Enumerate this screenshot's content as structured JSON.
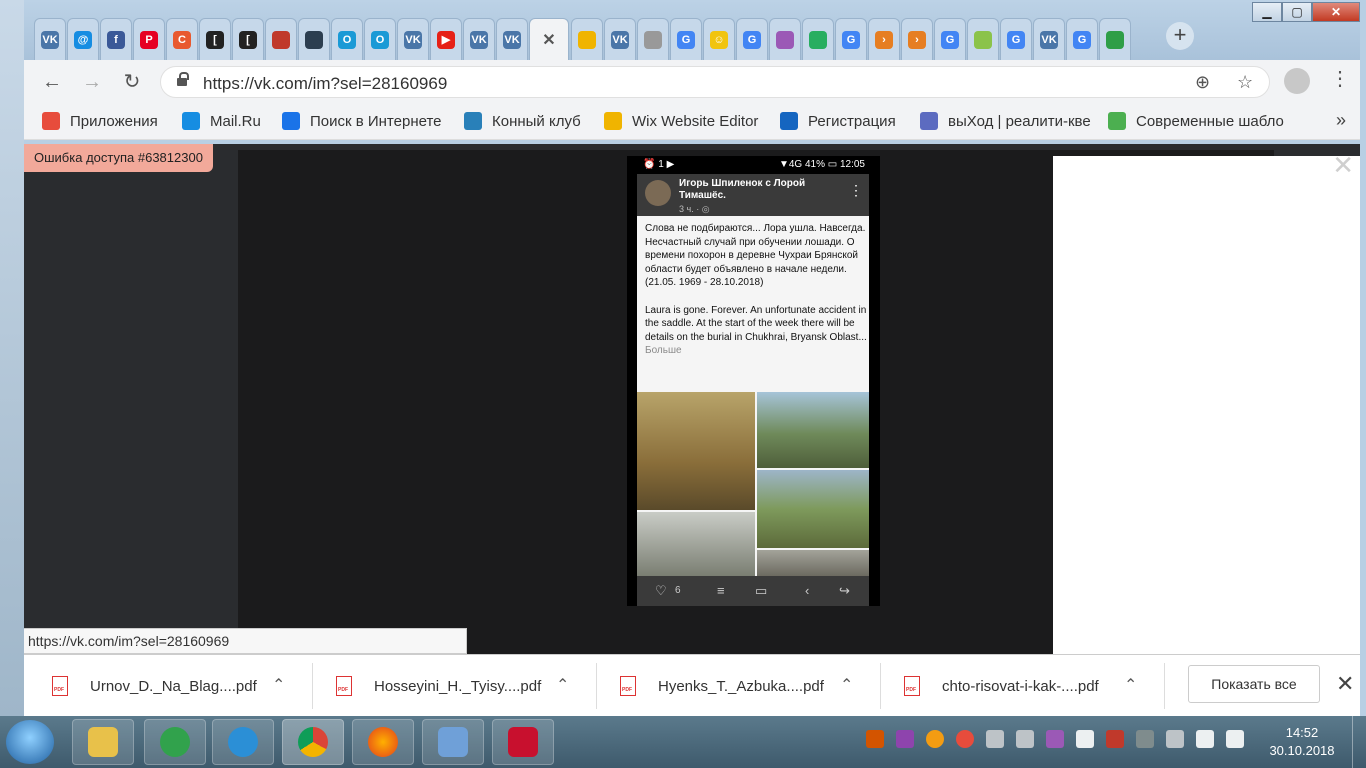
{
  "browser": {
    "url": "https://vk.com/im?sel=28160969",
    "tabs": [
      {
        "icon": "vk-icon",
        "glyph": "VK",
        "color": "#4a76a8"
      },
      {
        "icon": "mailru-icon",
        "glyph": "@",
        "color": "#168de2"
      },
      {
        "icon": "facebook-icon",
        "glyph": "f",
        "color": "#3b5998"
      },
      {
        "icon": "pinterest-icon",
        "glyph": "P",
        "color": "#e60023"
      },
      {
        "icon": "c-icon",
        "glyph": "C",
        "color": "#e8592f"
      },
      {
        "icon": "bracket-icon",
        "glyph": "[",
        "color": "#222222"
      },
      {
        "icon": "bracket-icon",
        "glyph": "[",
        "color": "#222222"
      },
      {
        "icon": "site-icon",
        "glyph": "",
        "color": "#c0392b"
      },
      {
        "icon": "site-icon",
        "glyph": "",
        "color": "#2c3e50"
      },
      {
        "icon": "ok-icon",
        "glyph": "O",
        "color": "#1a9ad6"
      },
      {
        "icon": "ok-icon",
        "glyph": "O",
        "color": "#1a9ad6"
      },
      {
        "icon": "vk-icon",
        "glyph": "VK",
        "color": "#4a76a8"
      },
      {
        "icon": "youtube-icon",
        "glyph": "▶",
        "color": "#e62117"
      },
      {
        "icon": "vk-icon",
        "glyph": "VK",
        "color": "#4a76a8"
      },
      {
        "icon": "vk-icon",
        "glyph": "VK",
        "color": "#4a76a8"
      },
      {
        "icon": "close-icon",
        "glyph": "✕",
        "color": "#555555",
        "active": true
      },
      {
        "icon": "wix-icon",
        "glyph": "",
        "color": "#f0b400"
      },
      {
        "icon": "vk-icon",
        "glyph": "VK",
        "color": "#4a76a8"
      },
      {
        "icon": "page-icon",
        "glyph": "",
        "color": "#999999"
      },
      {
        "icon": "google-icon",
        "glyph": "G",
        "color": "#4285f4"
      },
      {
        "icon": "smile-icon",
        "glyph": "☺",
        "color": "#f1c40f"
      },
      {
        "icon": "google-icon",
        "glyph": "G",
        "color": "#4285f4"
      },
      {
        "icon": "dots-icon",
        "glyph": "",
        "color": "#9b59b6"
      },
      {
        "icon": "dots-icon",
        "glyph": "",
        "color": "#27ae60"
      },
      {
        "icon": "google-icon",
        "glyph": "G",
        "color": "#4285f4"
      },
      {
        "icon": "arrow-icon",
        "glyph": "›",
        "color": "#e67e22"
      },
      {
        "icon": "arrow-icon",
        "glyph": "›",
        "color": "#e67e22"
      },
      {
        "icon": "google-icon",
        "glyph": "G",
        "color": "#4285f4"
      },
      {
        "icon": "leaf-icon",
        "glyph": "",
        "color": "#8bc34a"
      },
      {
        "icon": "google-icon",
        "glyph": "G",
        "color": "#4285f4"
      },
      {
        "icon": "vk-icon",
        "glyph": "VK",
        "color": "#4a76a8"
      },
      {
        "icon": "google-icon",
        "glyph": "G",
        "color": "#4285f4"
      },
      {
        "icon": "tree-icon",
        "glyph": "",
        "color": "#2e9e47"
      }
    ]
  },
  "bookmarks": [
    {
      "label": "Приложения",
      "icon": "apps-grid-icon",
      "color": "#e74c3c"
    },
    {
      "label": "Mail.Ru",
      "icon": "mailru-icon",
      "color": "#168de2"
    },
    {
      "label": "Поиск в Интернете",
      "icon": "search-icon",
      "color": "#1a73e8"
    },
    {
      "label": "Конный клуб",
      "icon": "butterfly-icon",
      "color": "#2980b9"
    },
    {
      "label": "Wix Website Editor",
      "icon": "wix-icon",
      "color": "#f0b400"
    },
    {
      "label": "Регистрация",
      "icon": "registration-icon",
      "color": "#1565c0"
    },
    {
      "label": "выХод | реалити-кве",
      "icon": "x-icon",
      "color": "#5c6bc0"
    },
    {
      "label": "Современные шабло",
      "icon": "template-icon",
      "color": "#4caf50"
    }
  ],
  "page": {
    "error_badge": "Ошибка доступа #63812300",
    "status_url": "https://vk.com/im?sel=28160969"
  },
  "phone": {
    "status_left": "⏰ 1 ▶",
    "status_right": "▼4G 41% ▭ 12:05",
    "author": "Игорь Шпиленок с Лорой Тимашёс.",
    "time": "3 ч. · ◎",
    "text": "Слова не подбираются... Лора ушла. Навсегда.\nНесчастный случай при обучении лошади. О времени похорон в деревне Чухраи Брянской области будет объявлено в начале недели.\n(21.05. 1969 - 28.10.2018)\n\nLaura is gone. Forever. An unfortunate accident in the saddle. At the start of the week there will be details on the burial in Chukhrai, Bryansk Oblast...",
    "more": "Больше",
    "likes": "6"
  },
  "downloads": [
    {
      "name": "Urnov_D._Na_Blag....pdf"
    },
    {
      "name": "Hosseyini_H._Tyisy....pdf"
    },
    {
      "name": "Hyenks_T._Azbuka....pdf"
    },
    {
      "name": "chto-risovat-i-kak-....pdf"
    }
  ],
  "downloads_show_all": "Показать все",
  "taskbar": {
    "time": "14:52",
    "date": "30.10.2018"
  }
}
